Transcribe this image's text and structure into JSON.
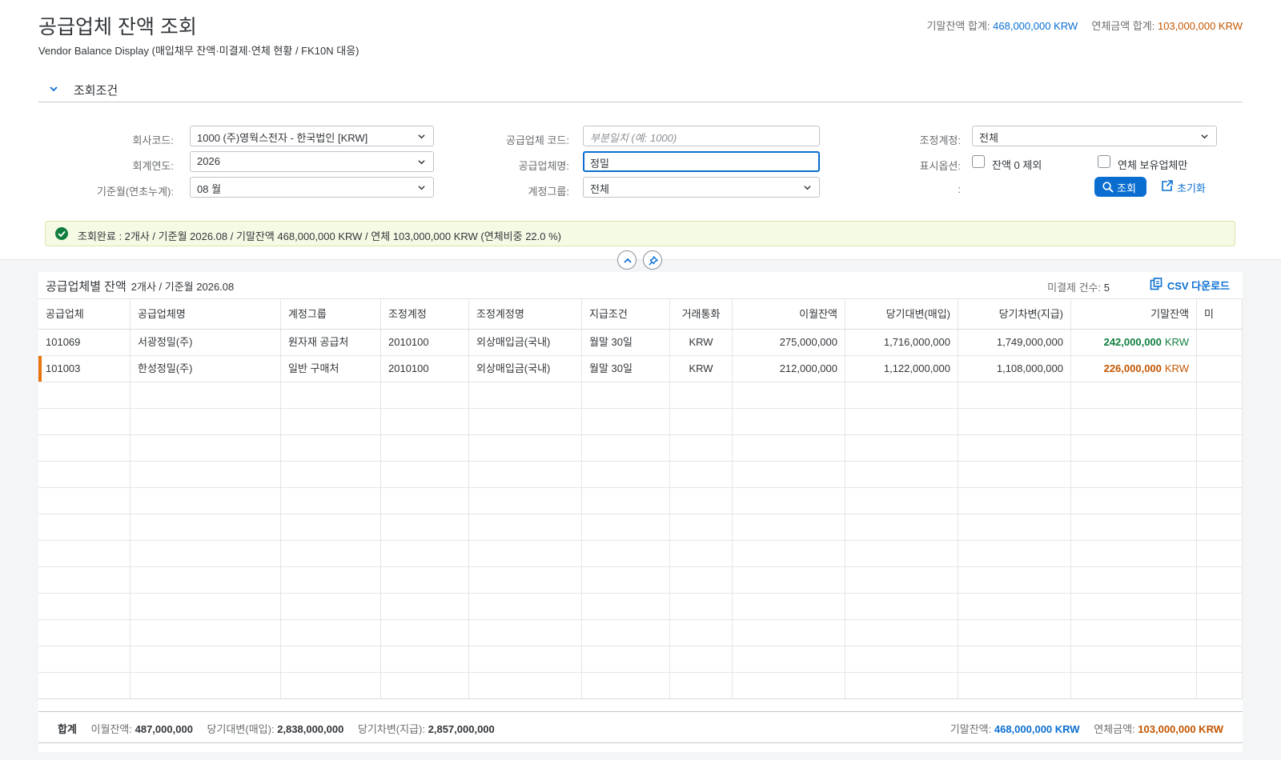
{
  "header": {
    "title": "공급업체 잔액 조회",
    "subtitle": "Vendor Balance Display (매입채무 잔액·미결제·연체 현황 / FK10N 대응)",
    "total_balance_label": "기말잔액 합계:",
    "total_balance_value": "468,000,000 KRW",
    "total_overdue_label": "연체금액 합계:",
    "total_overdue_value": "103,000,000 KRW"
  },
  "filter": {
    "title": "조회조건",
    "company_label": "회사코드:",
    "company_value": "1000 (주)영웍스전자 - 한국법인 [KRW]",
    "fiscal_year_label": "회계연도:",
    "fiscal_year_value": "2026",
    "period_label": "기준월(연초누계):",
    "period_value": "08 월",
    "vendor_code_label": "공급업체 코드:",
    "vendor_code_placeholder": "부분일치 (예: 1000)",
    "vendor_name_label": "공급업체명:",
    "vendor_name_value": "정밀",
    "account_group_label": "계정그룹:",
    "account_group_value": "전체",
    "recon_label": "조정계정:",
    "recon_value": "전체",
    "display_label": "표시옵션:",
    "opt_zero": "잔액 0 제외",
    "opt_overdue": "연체 보유업체만",
    "colon": ":",
    "search_label": "조회",
    "reset_label": "초기화"
  },
  "message": "조회완료 : 2개사 / 기준월 2026.08 / 기말잔액 468,000,000 KRW / 연체 103,000,000 KRW (연체비중 22.0 %)",
  "table": {
    "title": "공급업체별 잔액",
    "subtitle": "2개사 / 기준월 2026.08",
    "open_count_label": "미결제 건수:",
    "open_count_value": "5",
    "csv_label": "CSV 다운로드",
    "columns": [
      "공급업체",
      "공급업체명",
      "계정그룹",
      "조정계정",
      "조정계정명",
      "지급조건",
      "거래통화",
      "이월잔액",
      "당기대변(매입)",
      "당기차변(지급)",
      "기말잔액",
      "미"
    ],
    "rows": [
      {
        "vendor": "101069",
        "name": "서광정밀(주)",
        "group": "원자재 공급처",
        "recon": "2010100",
        "recon_name": "외상매입금(국내)",
        "terms": "월말 30일",
        "currency": "KRW",
        "carry": "275,000,000",
        "credit": "1,716,000,000",
        "debit": "1,749,000,000",
        "ending": "242,000,000",
        "ending_cur": "KRW"
      },
      {
        "vendor": "101003",
        "name": "한성정밀(주)",
        "group": "일반 구매처",
        "recon": "2010100",
        "recon_name": "외상매입금(국내)",
        "terms": "월말 30일",
        "currency": "KRW",
        "carry": "212,000,000",
        "credit": "1,122,000,000",
        "debit": "1,108,000,000",
        "ending": "226,000,000",
        "ending_cur": "KRW"
      }
    ]
  },
  "footer": {
    "sum_label": "합계",
    "carry_label": "이월잔액:",
    "carry_value": "487,000,000",
    "credit_label": "당기대변(매입):",
    "credit_value": "2,838,000,000",
    "debit_label": "당기차변(지급):",
    "debit_value": "2,857,000,000",
    "ending_label": "기말잔액:",
    "ending_value": "468,000,000 KRW",
    "overdue_label": "연체금액:",
    "overdue_value": "103,000,000 KRW"
  },
  "colors": {
    "accent": "#0a6ed1",
    "positive": "#107e3e",
    "warning": "#c35500",
    "row_marker": "#e9730c"
  },
  "icons": {
    "collapse": "chevron-down-icon",
    "search": "search-icon",
    "reset": "reset-icon",
    "csv": "export-icon",
    "success": "check-circle-icon",
    "pin": "pin-icon",
    "collapse_header": "chevron-up-icon"
  }
}
